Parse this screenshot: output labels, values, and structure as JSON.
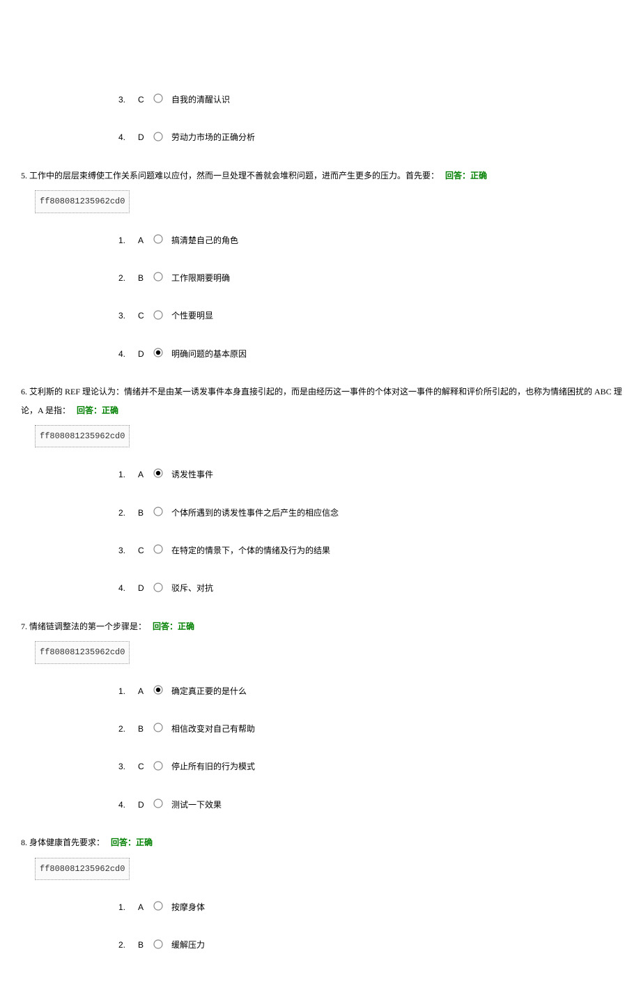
{
  "orphan": {
    "opts": [
      {
        "n": "3.",
        "l": "C",
        "sel": false,
        "txt": "自我的清醒认识"
      },
      {
        "n": "4.",
        "l": "D",
        "sel": false,
        "txt": "劳动力市场的正确分析"
      }
    ]
  },
  "questions": [
    {
      "num": "5.",
      "text": "工作中的层层束缚使工作关系问题难以应付，然而一旦处理不善就会堆积问题，进而产生更多的压力。首先要：",
      "answer_label": "回答：正确",
      "code": "ff808081235962cd0",
      "opts": [
        {
          "n": "1.",
          "l": "A",
          "sel": false,
          "txt": "搞清楚自己的角色"
        },
        {
          "n": "2.",
          "l": "B",
          "sel": false,
          "txt": "工作限期要明确"
        },
        {
          "n": "3.",
          "l": "C",
          "sel": false,
          "txt": "个性要明显"
        },
        {
          "n": "4.",
          "l": "D",
          "sel": true,
          "txt": "明确问题的基本原因"
        }
      ]
    },
    {
      "num": "6.",
      "text": "艾利斯的 REF 理论认为：情绪并不是由某一诱发事件本身直接引起的，而是由经历这一事件的个体对这一事件的解释和评价所引起的，也称为情绪困扰的 ABC 理论，A 是指：",
      "answer_label": "回答：正确",
      "code": "ff808081235962cd0",
      "opts": [
        {
          "n": "1.",
          "l": "A",
          "sel": true,
          "txt": "诱发性事件"
        },
        {
          "n": "2.",
          "l": "B",
          "sel": false,
          "txt": "个体所遇到的诱发性事件之后产生的相应信念"
        },
        {
          "n": "3.",
          "l": "C",
          "sel": false,
          "txt": "在特定的情景下，个体的情绪及行为的结果"
        },
        {
          "n": "4.",
          "l": "D",
          "sel": false,
          "txt": "驳斥、对抗"
        }
      ]
    },
    {
      "num": "7.",
      "text": "情绪链调整法的第一个步骤是：",
      "answer_label": "回答：正确",
      "code": "ff808081235962cd0",
      "opts": [
        {
          "n": "1.",
          "l": "A",
          "sel": true,
          "txt": "确定真正要的是什么"
        },
        {
          "n": "2.",
          "l": "B",
          "sel": false,
          "txt": "相信改变对自己有帮助"
        },
        {
          "n": "3.",
          "l": "C",
          "sel": false,
          "txt": "停止所有旧的行为模式"
        },
        {
          "n": "4.",
          "l": "D",
          "sel": false,
          "txt": "测试一下效果"
        }
      ]
    },
    {
      "num": "8.",
      "text": "身体健康首先要求：",
      "answer_label": "回答：正确",
      "code": "ff808081235962cd0",
      "opts": [
        {
          "n": "1.",
          "l": "A",
          "sel": false,
          "txt": "按摩身体"
        },
        {
          "n": "2.",
          "l": "B",
          "sel": false,
          "txt": "缓解压力"
        }
      ]
    }
  ]
}
